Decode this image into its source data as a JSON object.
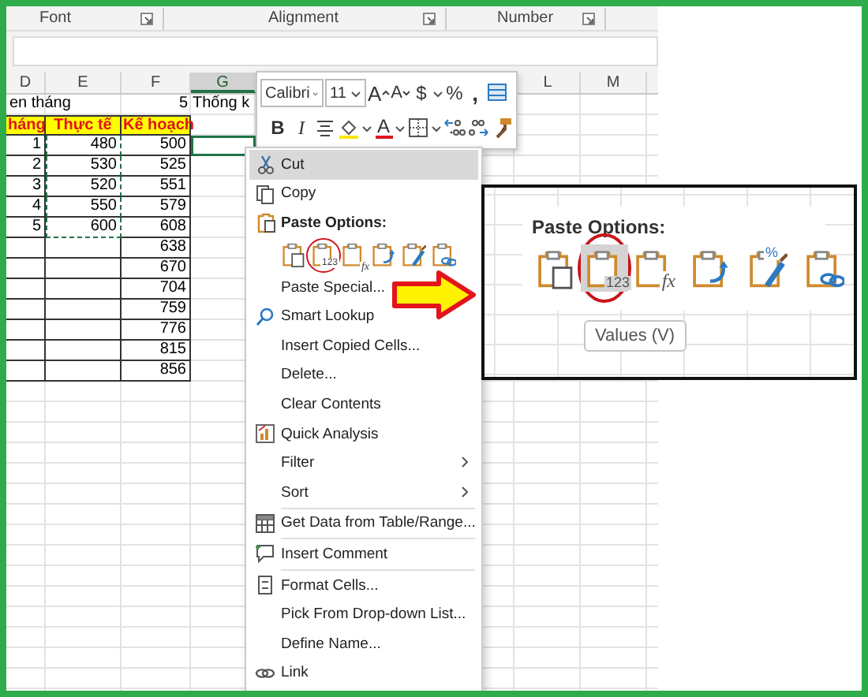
{
  "ribbon": {
    "groups": [
      {
        "label": "Font"
      },
      {
        "label": "Alignment"
      },
      {
        "label": "Number"
      }
    ]
  },
  "sheet": {
    "columns": [
      {
        "label": "D",
        "selected": false
      },
      {
        "label": "E",
        "selected": false
      },
      {
        "label": "F",
        "selected": false
      },
      {
        "label": "G",
        "selected": true
      },
      {
        "label": "L",
        "selected": false
      },
      {
        "label": "M",
        "selected": false
      }
    ],
    "rows": [
      {
        "kind": "title",
        "cells": [
          {
            "text": "en tháng"
          },
          {},
          {
            "text": "5"
          },
          {
            "text": "Thống k"
          }
        ]
      },
      {
        "kind": "header",
        "cells": [
          {
            "text": "háng"
          },
          {
            "text": "Thực tế"
          },
          {
            "text": "Kế hoạch"
          }
        ]
      },
      {
        "kind": "data",
        "cells": [
          {
            "text": "1"
          },
          {
            "text": "480",
            "copied": true
          },
          {
            "text": "500"
          },
          {
            "selected": true
          }
        ]
      },
      {
        "kind": "data",
        "cells": [
          {
            "text": "2"
          },
          {
            "text": "530",
            "copied": true
          },
          {
            "text": "525"
          }
        ]
      },
      {
        "kind": "data",
        "cells": [
          {
            "text": "3"
          },
          {
            "text": "520",
            "copied": true
          },
          {
            "text": "551"
          }
        ]
      },
      {
        "kind": "data",
        "cells": [
          {
            "text": "4"
          },
          {
            "text": "550",
            "copied": true
          },
          {
            "text": "579"
          }
        ]
      },
      {
        "kind": "data",
        "cells": [
          {
            "text": "5"
          },
          {
            "text": "600",
            "copied": true
          },
          {
            "text": "608"
          }
        ]
      },
      {
        "kind": "data",
        "cells": [
          {},
          {
            "copied": false
          },
          {
            "text": "638"
          }
        ]
      },
      {
        "kind": "data",
        "cells": [
          {},
          {
            "copied": false
          },
          {
            "text": "670"
          }
        ]
      },
      {
        "kind": "data",
        "cells": [
          {},
          {
            "copied": false
          },
          {
            "text": "704"
          }
        ]
      },
      {
        "kind": "data",
        "cells": [
          {},
          {
            "copied": false
          },
          {
            "text": "759"
          }
        ]
      },
      {
        "kind": "data",
        "cells": [
          {},
          {
            "copied": false
          },
          {
            "text": "776"
          }
        ]
      },
      {
        "kind": "data",
        "cells": [
          {},
          {
            "copied": false
          },
          {
            "text": "815"
          }
        ]
      },
      {
        "kind": "data",
        "cells": [
          {},
          {
            "copied": false
          },
          {
            "text": "856"
          }
        ]
      }
    ]
  },
  "mini_toolbar": {
    "rows": [
      {
        "buttons": [
          {
            "kind": "font",
            "value": "Calibri"
          },
          {
            "kind": "size",
            "value": "11"
          },
          {
            "kind": "grow",
            "label": "A"
          },
          {
            "kind": "shrink",
            "label": "A"
          },
          {
            "kind": "currency",
            "label": "$"
          },
          {
            "kind": "percent",
            "label": "%"
          },
          {
            "kind": "comma",
            "label": ","
          },
          {
            "kind": "format_table"
          }
        ]
      },
      {
        "buttons": [
          {
            "kind": "bold",
            "label": "B"
          },
          {
            "kind": "italic",
            "label": "I"
          },
          {
            "kind": "align"
          },
          {
            "kind": "fill"
          },
          {
            "kind": "font_color",
            "label": "A"
          },
          {
            "kind": "borders"
          },
          {
            "kind": "more_decimals"
          },
          {
            "kind": "fewer_decimals"
          },
          {
            "kind": "painter"
          }
        ]
      }
    ]
  },
  "context_menu": {
    "items": [
      {
        "kind": "cut",
        "label": "Cut",
        "highlighted": true
      },
      {
        "kind": "copy",
        "label": "Copy",
        "highlighted": false
      },
      {
        "kind": "paste_heading",
        "label": "Paste Options:"
      },
      {
        "kind": "paste_options",
        "options": [
          {
            "kind": "paste",
            "circled": false
          },
          {
            "kind": "values",
            "badge": "123",
            "circled": true
          },
          {
            "kind": "formulas",
            "badge": "fx",
            "circled": false
          },
          {
            "kind": "transpose",
            "circled": false
          },
          {
            "kind": "formatting",
            "circled": false
          },
          {
            "kind": "link",
            "circled": false
          }
        ]
      },
      {
        "kind": "plain",
        "label": "Paste Special...",
        "highlighted": false
      },
      {
        "kind": "lookup",
        "label": "Smart Lookup",
        "highlighted": false
      },
      {
        "kind": "plain",
        "label": "Insert Copied Cells...",
        "highlighted": false
      },
      {
        "kind": "plain",
        "label": "Delete...",
        "highlighted": false
      },
      {
        "kind": "plain",
        "label": "Clear Contents",
        "highlighted": false
      },
      {
        "kind": "quick_analysis",
        "label": "Quick Analysis",
        "highlighted": false
      },
      {
        "kind": "submenu",
        "label": "Filter",
        "highlighted": false
      },
      {
        "kind": "submenu",
        "label": "Sort",
        "highlighted": false
      },
      {
        "kind": "get_data",
        "label": "Get Data from Table/Range...",
        "highlighted": false,
        "separator_before": true
      },
      {
        "kind": "comment",
        "label": "Insert Comment",
        "highlighted": false,
        "separator_before": true
      },
      {
        "kind": "format",
        "label": "Format Cells...",
        "highlighted": false,
        "separator_before": true
      },
      {
        "kind": "plain",
        "label": "Pick From Drop-down List...",
        "highlighted": false
      },
      {
        "kind": "plain",
        "label": "Define Name...",
        "highlighted": false
      },
      {
        "kind": "link",
        "label": "Link",
        "highlighted": false
      }
    ]
  },
  "zoom_inset": {
    "heading": "Paste Options:",
    "options": [
      {
        "kind": "paste",
        "highlighted": false,
        "circled": false
      },
      {
        "kind": "values",
        "badge": "123",
        "highlighted": true,
        "circled": true
      },
      {
        "kind": "formulas",
        "badge": "fx",
        "highlighted": false,
        "circled": false
      },
      {
        "kind": "transpose",
        "highlighted": false,
        "circled": false
      },
      {
        "kind": "formatting",
        "badge": "%",
        "highlighted": false,
        "circled": false
      },
      {
        "kind": "link",
        "highlighted": false,
        "circled": false
      }
    ],
    "tooltip": "Values (V)"
  }
}
